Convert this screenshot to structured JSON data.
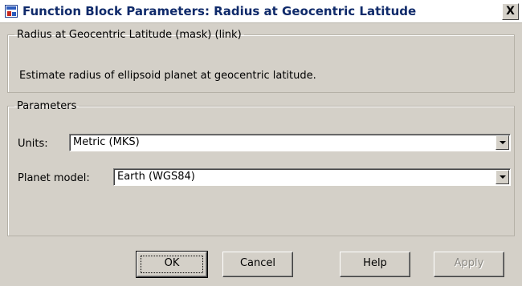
{
  "window": {
    "title": "Function Block Parameters: Radius at Geocentric Latitude",
    "close_glyph": "X",
    "icon": "simulink-block-icon"
  },
  "mask_group": {
    "legend": "Radius at Geocentric Latitude (mask) (link)",
    "description": "Estimate radius of ellipsoid planet at geocentric latitude."
  },
  "parameters_group": {
    "legend": "Parameters",
    "units": {
      "label": "Units:",
      "value": "Metric (MKS)"
    },
    "planet_model": {
      "label": "Planet model:",
      "value": "Earth (WGS84)"
    }
  },
  "buttons": {
    "ok": "OK",
    "cancel": "Cancel",
    "help": "Help",
    "apply": "Apply"
  }
}
